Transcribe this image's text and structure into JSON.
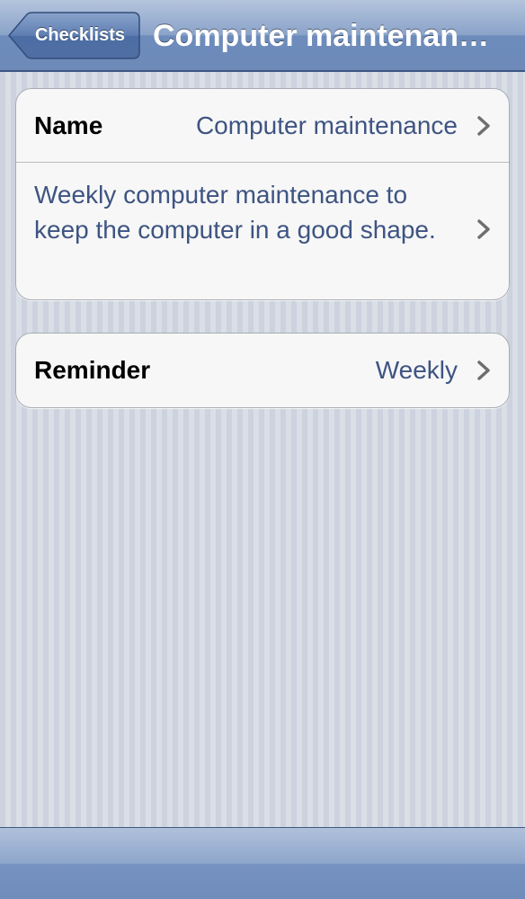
{
  "navbar": {
    "back_label": "Checklists",
    "title": "Computer maintenan…"
  },
  "checklist": {
    "name_label": "Name",
    "name_value": "Computer maintenance",
    "description": "Weekly computer maintenance to keep the computer in a good shape.",
    "reminder_label": "Reminder",
    "reminder_value": "Weekly"
  },
  "icons": {
    "back": "back-arrow-button-shape",
    "disclosure": "chevron-right-icon"
  },
  "colors": {
    "navbar": "#7f9ac4",
    "value_text": "#3e5482",
    "background": "#d3d9e3"
  }
}
